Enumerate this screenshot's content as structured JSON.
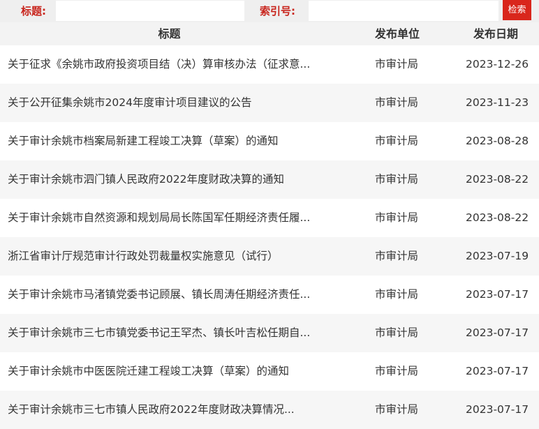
{
  "search": {
    "title_label": "标题:",
    "index_label": "索引号:",
    "title_value": "",
    "index_value": "",
    "button_label": "检索"
  },
  "table": {
    "headers": {
      "title": "标题",
      "unit": "发布单位",
      "date": "发布日期"
    },
    "rows": [
      {
        "title": "关于征求《余姚市政府投资项目结（决）算审核办法（征求意...",
        "unit": "市审计局",
        "date": "2023-12-26"
      },
      {
        "title": "关于公开征集余姚市2024年度审计项目建议的公告",
        "unit": "市审计局",
        "date": "2023-11-23"
      },
      {
        "title": "关于审计余姚市档案局新建工程竣工决算（草案）的通知",
        "unit": "市审计局",
        "date": "2023-08-28"
      },
      {
        "title": "关于审计余姚市泗门镇人民政府2022年度财政决算的通知",
        "unit": "市审计局",
        "date": "2023-08-22"
      },
      {
        "title": "关于审计余姚市自然资源和规划局局长陈国军任期经济责任履...",
        "unit": "市审计局",
        "date": "2023-08-22"
      },
      {
        "title": "浙江省审计厅规范审计行政处罚裁量权实施意见（试行）",
        "unit": "市审计局",
        "date": "2023-07-19"
      },
      {
        "title": "关于审计余姚市马渚镇党委书记顾展、镇长周涛任期经济责任...",
        "unit": "市审计局",
        "date": "2023-07-17"
      },
      {
        "title": "关于审计余姚市三七市镇党委书记王罕杰、镇长叶吉松任期自...",
        "unit": "市审计局",
        "date": "2023-07-17"
      },
      {
        "title": "关于审计余姚市中医医院迁建工程竣工决算（草案）的通知",
        "unit": "市审计局",
        "date": "2023-07-17"
      },
      {
        "title": "关于审计余姚市三七市镇人民政府2022年度财政决算情况...",
        "unit": "市审计局",
        "date": "2023-07-17"
      }
    ]
  }
}
